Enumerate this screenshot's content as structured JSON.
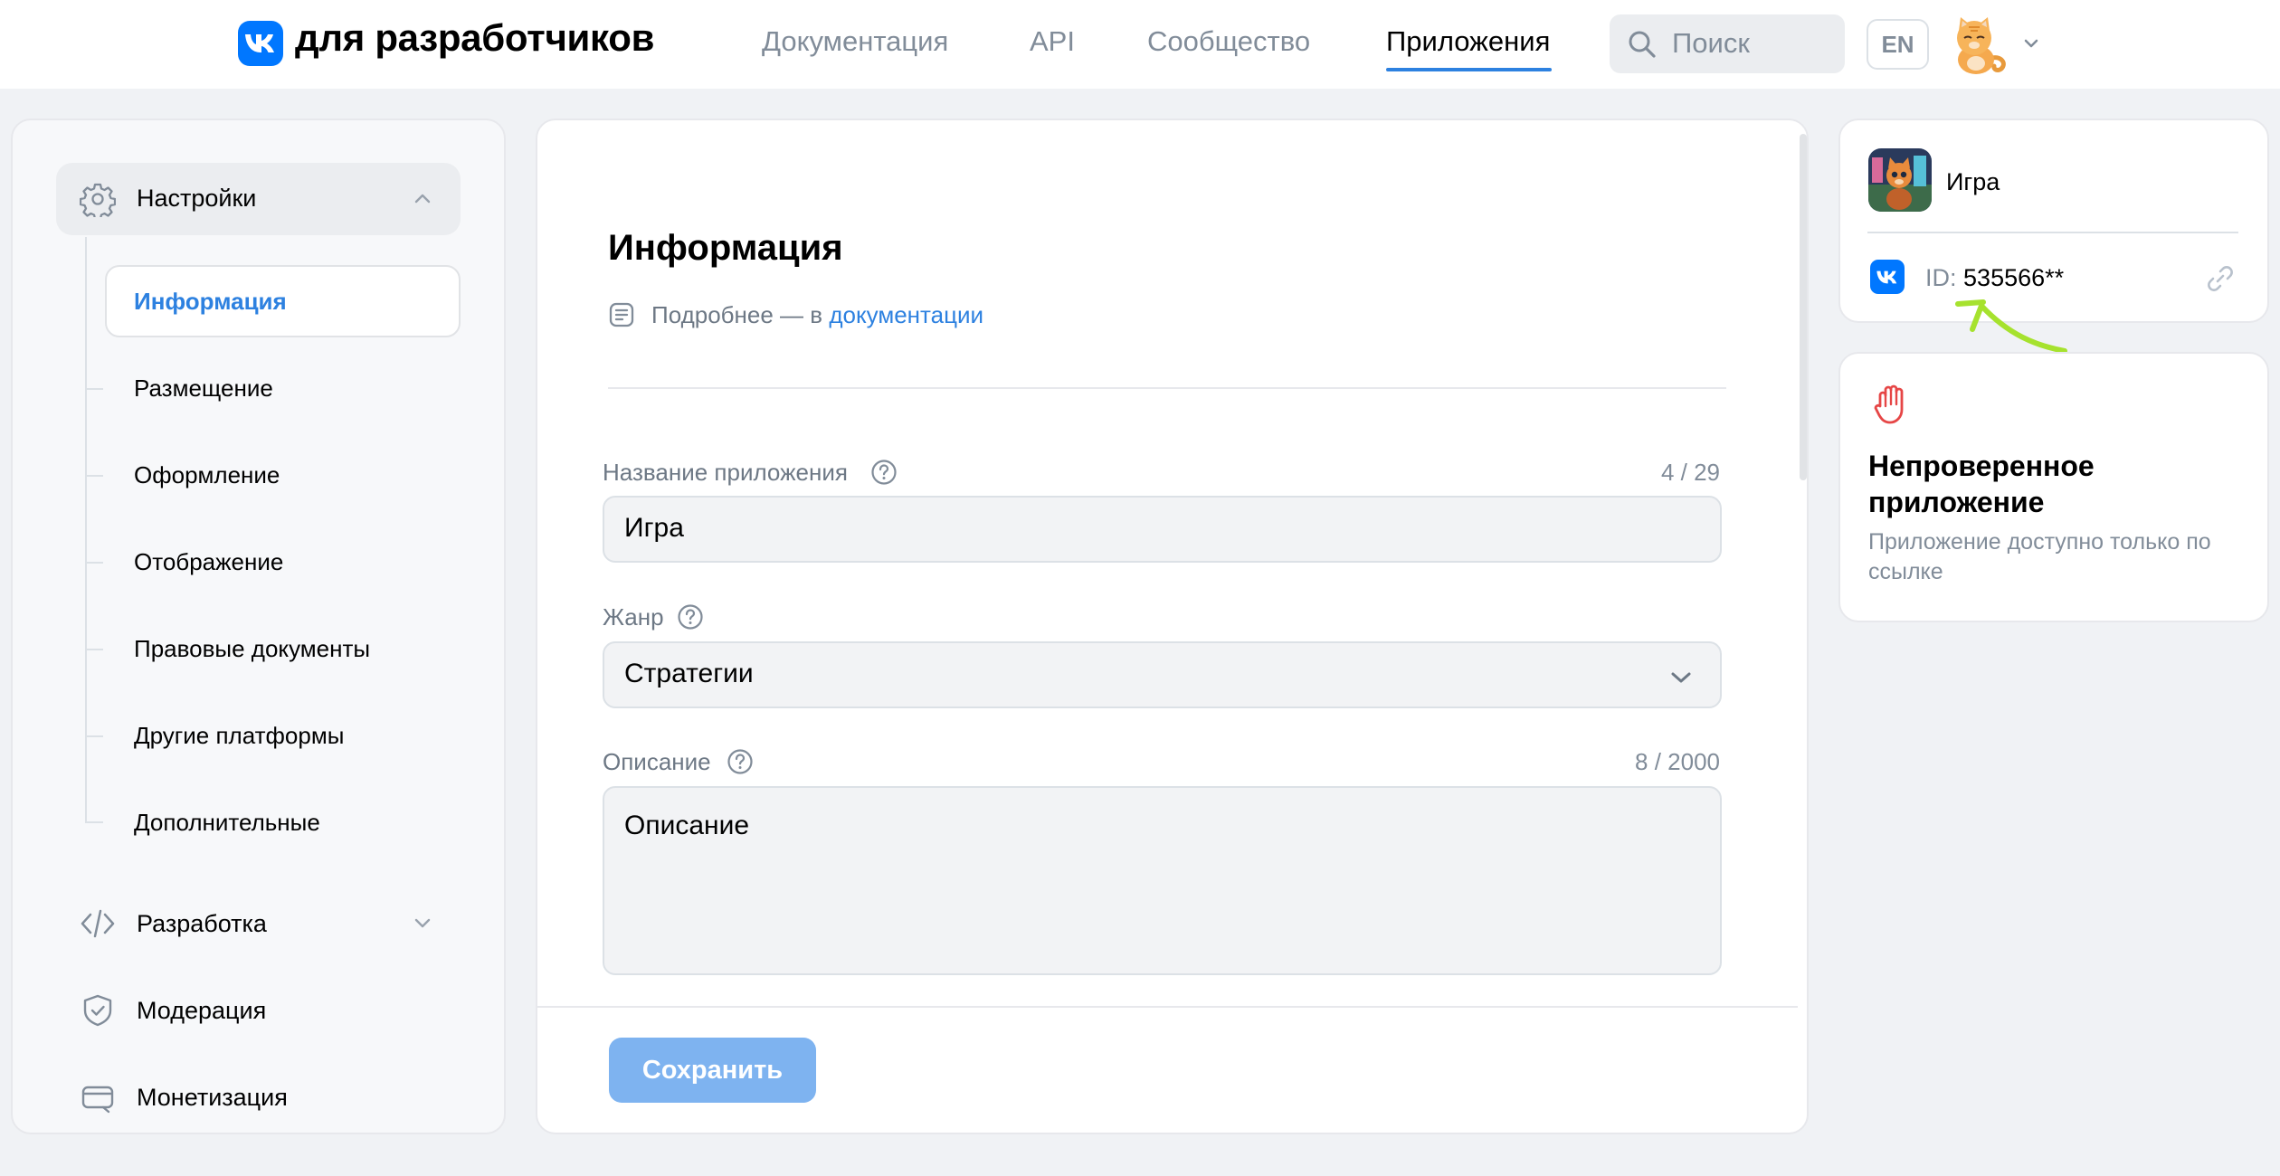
{
  "header": {
    "logo_text": "для разработчиков",
    "nav": [
      {
        "label": "Документация"
      },
      {
        "label": "API"
      },
      {
        "label": "Сообщество"
      },
      {
        "label": "Приложения",
        "active": true
      }
    ],
    "search_placeholder": "Поиск",
    "lang": "EN",
    "avatar_icon": "cat-avatar-icon"
  },
  "sidebar": {
    "settings": {
      "label": "Настройки",
      "expanded": true
    },
    "sub_items": [
      {
        "label": "Информация",
        "active": true
      },
      {
        "label": "Размещение"
      },
      {
        "label": "Оформление"
      },
      {
        "label": "Отображение"
      },
      {
        "label": "Правовые документы"
      },
      {
        "label": "Другие платформы"
      },
      {
        "label": "Дополнительные"
      }
    ],
    "sections": [
      {
        "label": "Разработка",
        "icon": "code-icon",
        "expandable": true
      },
      {
        "label": "Модерация",
        "icon": "shield-check-icon"
      },
      {
        "label": "Монетизация",
        "icon": "card-icon"
      }
    ]
  },
  "main": {
    "title": "Информация",
    "doc_prefix": "Подробнее — в ",
    "doc_link": "документации",
    "fields": {
      "name": {
        "label": "Название приложения",
        "value": "Игра",
        "counter": "4 / 29"
      },
      "genre": {
        "label": "Жанр",
        "value": "Стратегии"
      },
      "description": {
        "label": "Описание",
        "value": "Описание",
        "counter": "8 / 2000"
      }
    },
    "save_label": "Сохранить"
  },
  "app_card": {
    "name": "Игра",
    "id_label": "ID:",
    "id_value": "535566**"
  },
  "status_card": {
    "title": "Непроверенное приложение",
    "text": "Приложение доступно только по ссылке"
  },
  "colors": {
    "accent": "#2d81e0",
    "vk_blue": "#0077ff",
    "annotation_arrow": "#a6e22e",
    "warning_red": "#e64646"
  }
}
